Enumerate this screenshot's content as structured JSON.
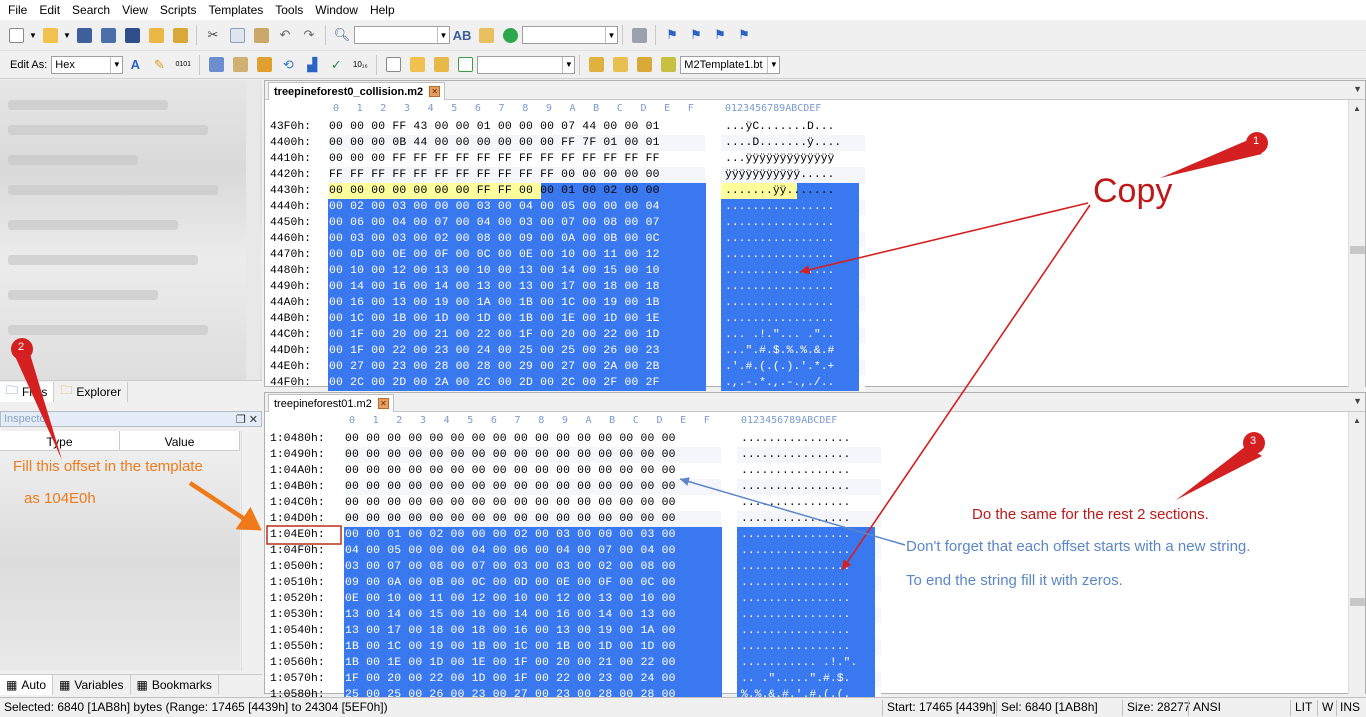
{
  "menu": [
    "File",
    "Edit",
    "Search",
    "View",
    "Scripts",
    "Templates",
    "Tools",
    "Window",
    "Help"
  ],
  "toolbar2": {
    "edit_as_label": "Edit As:",
    "edit_as_value": "Hex",
    "template_combo": "M2Template1.bt"
  },
  "left_panel": {
    "tabs": [
      {
        "label": "Files",
        "icon": "folder-icon"
      },
      {
        "label": "Explorer",
        "icon": "explorer-icon"
      }
    ],
    "inspector_title": "Inspector",
    "inspector_columns": [
      "Type",
      "Value"
    ],
    "inspector_tabs": [
      {
        "label": "Auto"
      },
      {
        "label": "Variables"
      },
      {
        "label": "Bookmarks"
      }
    ]
  },
  "editor1": {
    "filename": "treepineforest0_collision.m2",
    "column_header": [
      "0",
      "1",
      "2",
      "3",
      "4",
      "5",
      "6",
      "7",
      "8",
      "9",
      "A",
      "B",
      "C",
      "D",
      "E",
      "F"
    ],
    "ascii_header": "0123456789ABCDEF",
    "rows": [
      {
        "offset": "43F0h:",
        "bytes": "00 00 00 FF 43 00 00 01 00 00 00 07 44 00 00 01",
        "ascii": "...ÿC.......D..."
      },
      {
        "offset": "4400h:",
        "bytes": "00 00 00 0B 44 00 00 00 00 00 00 FF 7F 01 00 01",
        "ascii": "....D.......ÿ...."
      },
      {
        "offset": "4410h:",
        "bytes": "00 00 00 FF FF FF FF FF FF FF FF FF FF FF FF FF",
        "ascii": "...ÿÿÿÿÿÿÿÿÿÿÿÿÿ"
      },
      {
        "offset": "4420h:",
        "bytes": "FF FF FF FF FF FF FF FF FF FF FF 00 00 00 00 00",
        "ascii": "ÿÿÿÿÿÿÿÿÿÿÿ....."
      },
      {
        "offset": "4430h:",
        "bytes": "00 00 00 00 00 00 00 FF FF 00 00 01 00 02 00 00",
        "ascii": ".......ÿÿ......."
      },
      {
        "offset": "4440h:",
        "bytes": "00 02 00 03 00 00 00 03 00 04 00 05 00 00 00 04",
        "ascii": "................"
      },
      {
        "offset": "4450h:",
        "bytes": "00 06 00 04 00 07 00 04 00 03 00 07 00 08 00 07",
        "ascii": "................"
      },
      {
        "offset": "4460h:",
        "bytes": "00 03 00 03 00 02 00 08 00 09 00 0A 00 0B 00 0C",
        "ascii": "................"
      },
      {
        "offset": "4470h:",
        "bytes": "00 0D 00 0E 00 0F 00 0C 00 0E 00 10 00 11 00 12",
        "ascii": "................"
      },
      {
        "offset": "4480h:",
        "bytes": "00 10 00 12 00 13 00 10 00 13 00 14 00 15 00 10",
        "ascii": "................"
      },
      {
        "offset": "4490h:",
        "bytes": "00 14 00 16 00 14 00 13 00 13 00 17 00 18 00 18",
        "ascii": "................"
      },
      {
        "offset": "44A0h:",
        "bytes": "00 16 00 13 00 19 00 1A 00 1B 00 1C 00 19 00 1B",
        "ascii": "................"
      },
      {
        "offset": "44B0h:",
        "bytes": "00 1C 00 1B 00 1D 00 1D 00 1B 00 1E 00 1D 00 1E",
        "ascii": "................"
      },
      {
        "offset": "44C0h:",
        "bytes": "00 1F 00 20 00 21 00 22 00 1F 00 20 00 22 00 1D",
        "ascii": "... .!.\"... .\".."
      },
      {
        "offset": "44D0h:",
        "bytes": "00 1F 00 22 00 23 00 24 00 25 00 25 00 26 00 23",
        "ascii": "...\".#.$.%.%.&.#"
      },
      {
        "offset": "44E0h:",
        "bytes": "00 27 00 23 00 28 00 28 00 29 00 27 00 2A 00 2B",
        "ascii": ".'.#.(.(.).'.*.+"
      },
      {
        "offset": "44F0h:",
        "bytes": "00 2C 00 2D 00 2A 00 2C 00 2D 00 2C 00 2F 00 2F",
        "ascii": ".,.-.*.,.-.,./.."
      }
    ]
  },
  "editor2": {
    "filename": "treepineforest01.m2",
    "column_header": [
      "0",
      "1",
      "2",
      "3",
      "4",
      "5",
      "6",
      "7",
      "8",
      "9",
      "A",
      "B",
      "C",
      "D",
      "E",
      "F"
    ],
    "ascii_header": "0123456789ABCDEF",
    "rows": [
      {
        "offset": "1:0480h:",
        "bytes": "00 00 00 00 00 00 00 00 00 00 00 00 00 00 00 00",
        "ascii": "................"
      },
      {
        "offset": "1:0490h:",
        "bytes": "00 00 00 00 00 00 00 00 00 00 00 00 00 00 00 00",
        "ascii": "................"
      },
      {
        "offset": "1:04A0h:",
        "bytes": "00 00 00 00 00 00 00 00 00 00 00 00 00 00 00 00",
        "ascii": "................"
      },
      {
        "offset": "1:04B0h:",
        "bytes": "00 00 00 00 00 00 00 00 00 00 00 00 00 00 00 00",
        "ascii": "................"
      },
      {
        "offset": "1:04C0h:",
        "bytes": "00 00 00 00 00 00 00 00 00 00 00 00 00 00 00 00",
        "ascii": "................"
      },
      {
        "offset": "1:04D0h:",
        "bytes": "00 00 00 00 00 00 00 00 00 00 00 00 00 00 00 00",
        "ascii": "................"
      },
      {
        "offset": "1:04E0h:",
        "bytes": "00 00 01 00 02 00 00 00 02 00 03 00 00 00 03 00",
        "ascii": "................"
      },
      {
        "offset": "1:04F0h:",
        "bytes": "04 00 05 00 00 00 04 00 06 00 04 00 07 00 04 00",
        "ascii": "................"
      },
      {
        "offset": "1:0500h:",
        "bytes": "03 00 07 00 08 00 07 00 03 00 03 00 02 00 08 00",
        "ascii": "................"
      },
      {
        "offset": "1:0510h:",
        "bytes": "09 00 0A 00 0B 00 0C 00 0D 00 0E 00 0F 00 0C 00",
        "ascii": "................"
      },
      {
        "offset": "1:0520h:",
        "bytes": "0E 00 10 00 11 00 12 00 10 00 12 00 13 00 10 00",
        "ascii": "................"
      },
      {
        "offset": "1:0530h:",
        "bytes": "13 00 14 00 15 00 10 00 14 00 16 00 14 00 13 00",
        "ascii": "................"
      },
      {
        "offset": "1:0540h:",
        "bytes": "13 00 17 00 18 00 18 00 16 00 13 00 19 00 1A 00",
        "ascii": "................"
      },
      {
        "offset": "1:0550h:",
        "bytes": "1B 00 1C 00 19 00 1B 00 1C 00 1B 00 1D 00 1D 00",
        "ascii": "................"
      },
      {
        "offset": "1:0560h:",
        "bytes": "1B 00 1E 00 1D 00 1E 00 1F 00 20 00 21 00 22 00",
        "ascii": "........... .!.\"."
      },
      {
        "offset": "1:0570h:",
        "bytes": "1F 00 20 00 22 00 1D 00 1F 00 22 00 23 00 24 00",
        "ascii": ".. .\".....\".#.$."
      },
      {
        "offset": "1:0580h:",
        "bytes": "25 00 25 00 26 00 23 00 27 00 23 00 28 00 28 00",
        "ascii": "%.%.&.#.'.#.(.(."
      }
    ]
  },
  "annotations": {
    "copy": "Copy",
    "badge1": "1",
    "badge2": "2",
    "badge3": "3",
    "fill_offset_line1": "Fill this offset in the template",
    "fill_offset_line2": "as 104E0h",
    "do_same": "Do the same for the rest 2 sections.",
    "dont_forget": "Don't forget that each offset starts with a new string.",
    "to_end": "To end the string fill it with zeros."
  },
  "status": {
    "selected": "Selected: 6840 [1AB8h] bytes (Range: 17465 [4439h] to 24304 [5EF0h])",
    "start": "Start: 17465 [4439h]",
    "sel": "Sel: 6840 [1AB8h]",
    "size": "Size: 28277",
    "encoding": "ANSI",
    "lit": "LIT",
    "w": "W",
    "ins": "INS"
  },
  "colors": {
    "selection": "#3a78ef",
    "highlight_row": "#fffe9c",
    "annotation_red": "#d42020",
    "annotation_orange": "#f07a1a",
    "annotation_blue": "#5b86c8",
    "offset_box": "#b83018"
  }
}
